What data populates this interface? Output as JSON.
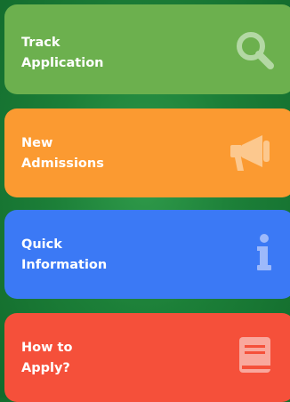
{
  "cards": [
    {
      "label": "Track\nApplication",
      "icon": "search-icon",
      "color": "#6cb04e"
    },
    {
      "label": "New\nAdmissions",
      "icon": "megaphone-icon",
      "color": "#fb9a31"
    },
    {
      "label": "Quick\nInformation",
      "icon": "info-icon",
      "color": "#3b79f5"
    },
    {
      "label": "How to\nApply?",
      "icon": "book-icon",
      "color": "#f5503a"
    }
  ]
}
